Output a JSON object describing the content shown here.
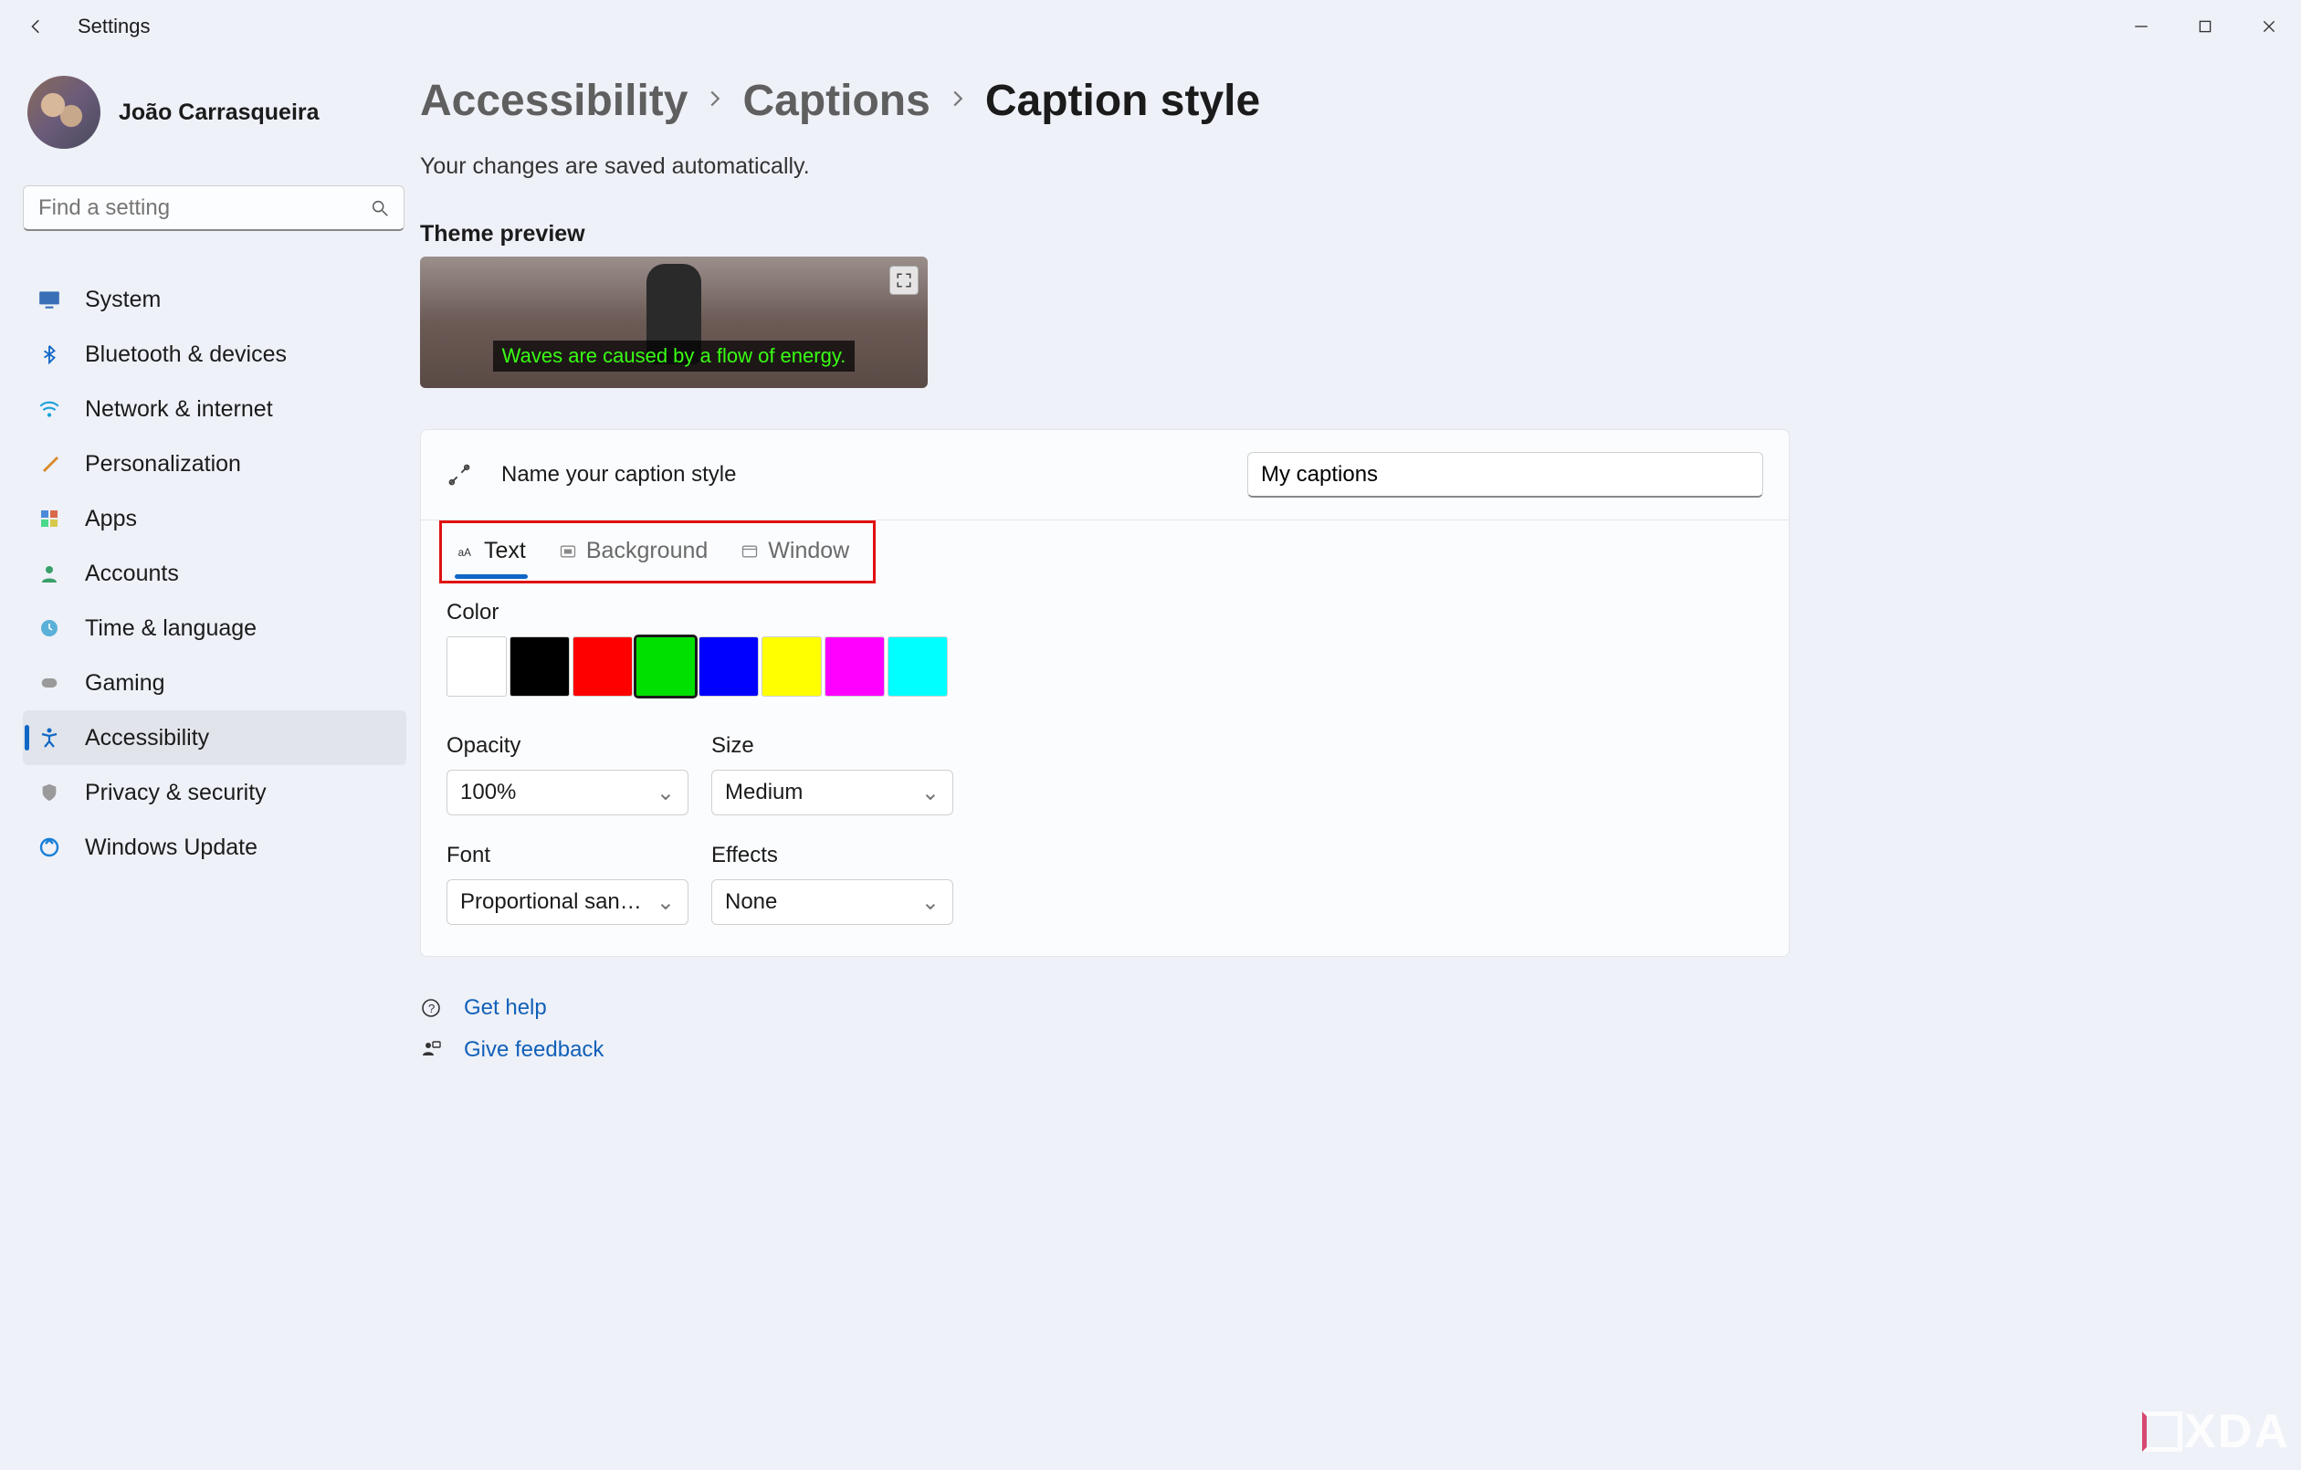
{
  "app": {
    "title": "Settings"
  },
  "user": {
    "name": "João Carrasqueira"
  },
  "search": {
    "placeholder": "Find a setting"
  },
  "sidebar": {
    "items": [
      {
        "label": "System"
      },
      {
        "label": "Bluetooth & devices"
      },
      {
        "label": "Network & internet"
      },
      {
        "label": "Personalization"
      },
      {
        "label": "Apps"
      },
      {
        "label": "Accounts"
      },
      {
        "label": "Time & language"
      },
      {
        "label": "Gaming"
      },
      {
        "label": "Accessibility"
      },
      {
        "label": "Privacy & security"
      },
      {
        "label": "Windows Update"
      }
    ]
  },
  "breadcrumb": {
    "a": "Accessibility",
    "b": "Captions",
    "c": "Caption style"
  },
  "savenote": "Your changes are saved automatically.",
  "preview": {
    "label": "Theme preview",
    "caption_text": "Waves are caused by a flow of energy."
  },
  "style_name": {
    "label": "Name your caption style",
    "value": "My captions"
  },
  "tabs": {
    "text": "Text",
    "background": "Background",
    "window": "Window"
  },
  "color": {
    "label": "Color",
    "swatches": [
      "#ffffff",
      "#000000",
      "#ff0000",
      "#00e000",
      "#0000ff",
      "#ffff00",
      "#ff00ff",
      "#00ffff"
    ],
    "selected_index": 3
  },
  "opacity": {
    "label": "Opacity",
    "value": "100%"
  },
  "size": {
    "label": "Size",
    "value": "Medium"
  },
  "font": {
    "label": "Font",
    "value": "Proportional sans s…"
  },
  "effects": {
    "label": "Effects",
    "value": "None"
  },
  "help": {
    "get_help": "Get help",
    "feedback": "Give feedback"
  },
  "watermark": "XDA"
}
